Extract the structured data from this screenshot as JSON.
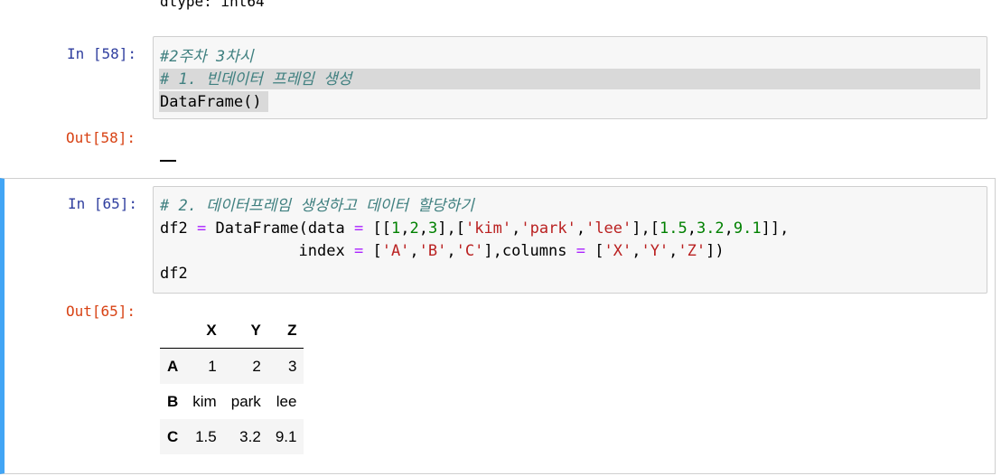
{
  "partial_output": "dtype: int64",
  "cells": [
    {
      "in_prompt": "In [58]:",
      "out_prompt": "Out[58]:",
      "code": [
        "#2주차 3차시",
        "# 1. 빈데이터 프레임 생성",
        "DataFrame()"
      ]
    },
    {
      "in_prompt": "In [65]:",
      "out_prompt": "Out[65]:",
      "code_comment": "# 2. 데이터프레임 생성하고 데이터 할당하기",
      "code_tokens": {
        "df2": "df2",
        "eq": "=",
        "dataframe_call": "DataFrame(data",
        "open": "[[",
        "n1": "1",
        "n2": "2",
        "n3": "3",
        "s_kim": "'kim'",
        "s_park": "'park'",
        "s_lee": "'lee'",
        "f1": "1.5",
        "f2": "3.2",
        "f3": "9.1",
        "indent": "               ",
        "index_kw": "index",
        "s_A": "'A'",
        "s_B": "'B'",
        "s_C": "'C'",
        "columns_kw": "columns",
        "s_X": "'X'",
        "s_Y": "'Y'",
        "s_Z": "'Z'"
      },
      "code_last": "df2",
      "output_table": {
        "columns": [
          "X",
          "Y",
          "Z"
        ],
        "rows": [
          {
            "index": "A",
            "values": [
              "1",
              "2",
              "3"
            ]
          },
          {
            "index": "B",
            "values": [
              "kim",
              "park",
              "lee"
            ]
          },
          {
            "index": "C",
            "values": [
              "1.5",
              "3.2",
              "9.1"
            ]
          }
        ]
      }
    }
  ],
  "colors": {
    "in_prompt": "#303f9f",
    "out_prompt": "#d84315",
    "selected_cell_border": "#42a5f5",
    "comment": "#408080",
    "string": "#ba2121",
    "number": "#008000",
    "operator": "#aa22ff"
  }
}
